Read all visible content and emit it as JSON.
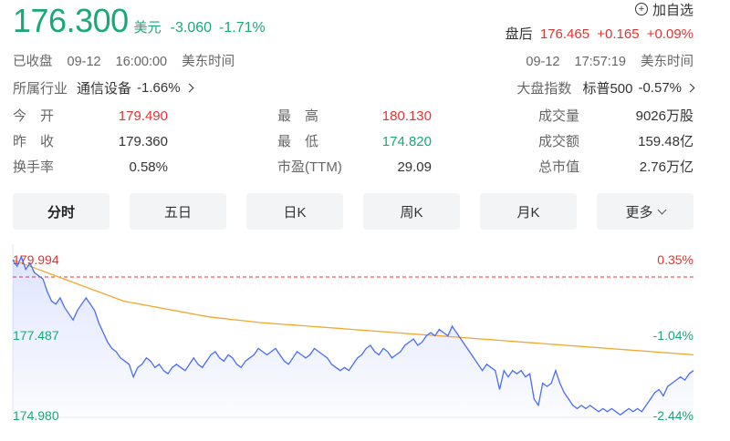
{
  "header": {
    "price": "176.300",
    "currency": "美元",
    "change": "-3.060",
    "change_pct": "-1.71%",
    "watch_label": "加自选",
    "after_hours_label": "盘后",
    "after_hours_price": "176.465",
    "after_hours_change": "+0.165",
    "after_hours_pct": "+0.09%",
    "status": "已收盘",
    "close_date": "09-12",
    "close_time": "16:00:00",
    "timezone": "美东时间",
    "after_date": "09-12",
    "after_time": "17:57:19",
    "after_timezone": "美东时间",
    "industry_label": "所属行业",
    "industry_name": "通信设备",
    "industry_change": "-1.66%",
    "index_label": "大盘指数",
    "index_name": "标普500",
    "index_change": "-0.57%"
  },
  "stats": {
    "open_label": "今　开",
    "open": "179.490",
    "high_label": "最　高",
    "high": "180.130",
    "volume_label": "成交量",
    "volume": "9026万股",
    "prev_close_label": "昨　收",
    "prev_close": "179.360",
    "low_label": "最　低",
    "low": "174.820",
    "turnover_label": "成交额",
    "turnover": "159.48亿",
    "turnover_rate_label": "换手率",
    "turnover_rate": "0.58%",
    "pe_label": "市盈(TTM)",
    "pe": "29.09",
    "market_cap_label": "总市值",
    "market_cap": "2.76万亿"
  },
  "tabs": [
    "分时",
    "五日",
    "日K",
    "周K",
    "月K",
    "更多"
  ],
  "colors": {
    "up": "#e93030",
    "down": "#1aa877",
    "price_line": "#4a6cf7",
    "avg_line": "#f0a830"
  },
  "chart_data": {
    "type": "line",
    "y_ticks_left": [
      "179.994",
      "177.487",
      "174.980"
    ],
    "y_ticks_right": [
      "0.35%",
      "-1.04%",
      "-2.44%"
    ],
    "ylim": [
      174.98,
      179.994
    ],
    "prev_close": 179.36,
    "series": [
      {
        "values": [
          179.9,
          179.7,
          180.0,
          179.6,
          179.8,
          179.5,
          179.4,
          179.3,
          178.9,
          178.6,
          178.5,
          178.7,
          178.4,
          178.2,
          178.0,
          178.3,
          178.5,
          178.7,
          178.5,
          178.3,
          177.9,
          177.6,
          177.3,
          177.1,
          177.0,
          176.8,
          176.7,
          176.6,
          176.2,
          176.5,
          176.6,
          176.8,
          176.7,
          176.5,
          176.6,
          176.4,
          176.3,
          176.5,
          176.6,
          176.5,
          176.4,
          176.6,
          176.8,
          176.6,
          176.5,
          176.7,
          176.9,
          177.0,
          176.8,
          176.7,
          176.9,
          176.8,
          176.6,
          176.5,
          176.7,
          176.8,
          176.9,
          177.1,
          177.0,
          176.9,
          177.0,
          177.1,
          176.9,
          176.7,
          176.6,
          176.8,
          177.0,
          176.9,
          176.8,
          176.9,
          177.1,
          177.0,
          176.9,
          176.8,
          176.6,
          176.5,
          176.4,
          176.5,
          176.4,
          176.6,
          176.8,
          176.9,
          177.1,
          177.2,
          177.0,
          176.9,
          177.1,
          177.0,
          176.8,
          176.9,
          177.0,
          177.2,
          177.3,
          177.4,
          177.2,
          177.3,
          177.5,
          177.6,
          177.5,
          177.7,
          177.6,
          177.5,
          177.8,
          177.6,
          177.4,
          177.2,
          177.0,
          176.8,
          176.6,
          176.4,
          176.6,
          176.5,
          176.4,
          175.8,
          176.4,
          176.2,
          176.4,
          176.3,
          176.4,
          176.2,
          176.3,
          175.5,
          175.3,
          176.0,
          175.9,
          176.0,
          176.4,
          176.0,
          175.7,
          175.5,
          175.3,
          175.2,
          175.3,
          175.2,
          175.3,
          175.2,
          175.1,
          175.2,
          175.1,
          175.2,
          175.1,
          175.0,
          175.1,
          175.2,
          175.1,
          175.2,
          175.1,
          175.3,
          175.5,
          175.7,
          175.8,
          175.6,
          175.9,
          176.0,
          176.1,
          176.2,
          176.1,
          176.3,
          176.4
        ]
      },
      {
        "values": [
          179.9,
          179.8,
          179.7,
          179.6,
          179.5,
          179.4,
          179.3,
          179.2,
          179.1,
          179.0,
          178.9,
          178.8,
          178.7,
          178.6,
          178.55,
          178.5,
          178.45,
          178.4,
          178.35,
          178.3,
          178.25,
          178.2,
          178.15,
          178.1,
          178.07,
          178.04,
          178.01,
          177.98,
          177.95,
          177.92,
          177.9,
          177.88,
          177.86,
          177.84,
          177.82,
          177.8,
          177.78,
          177.76,
          177.74,
          177.72,
          177.7,
          177.68,
          177.66,
          177.64,
          177.62,
          177.6,
          177.58,
          177.56,
          177.54,
          177.52,
          177.5,
          177.48,
          177.46,
          177.44,
          177.42,
          177.4,
          177.38,
          177.36,
          177.34,
          177.32,
          177.3,
          177.28,
          177.26,
          177.24,
          177.22,
          177.2,
          177.18,
          177.16,
          177.14,
          177.12,
          177.1,
          177.08,
          177.06,
          177.04,
          177.02,
          177.0,
          176.98,
          176.96,
          176.94,
          176.92,
          176.9
        ]
      }
    ]
  }
}
